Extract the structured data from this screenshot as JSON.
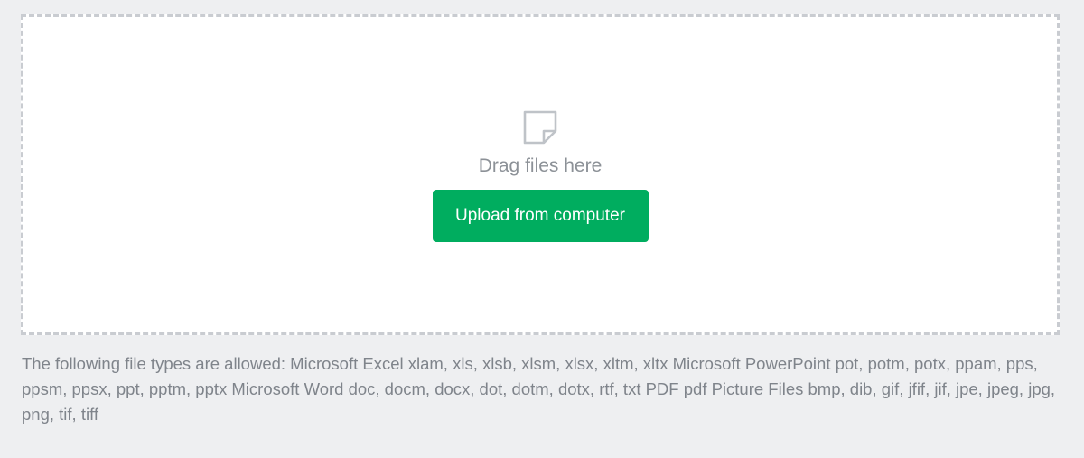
{
  "dropzone": {
    "icon": "file-icon",
    "drag_text": "Drag files here",
    "upload_button_label": "Upload from computer"
  },
  "allowed_types_text": "The following file types are allowed: Microsoft Excel xlam, xls, xlsb, xlsm, xlsx, xltm, xltx Microsoft PowerPoint pot, potm, potx, ppam, pps, ppsm, ppsx, ppt, pptm, pptx Microsoft Word doc, docm, docx, dot, dotm, dotx, rtf, txt PDF pdf Picture Files bmp, dib, gif, jfif, jif, jpe, jpeg, jpg, png, tif, tiff",
  "colors": {
    "page_background": "#eeeff1",
    "dropzone_border": "#c9ccd1",
    "button_background": "#00ad5f",
    "muted_text": "#8c9197"
  }
}
